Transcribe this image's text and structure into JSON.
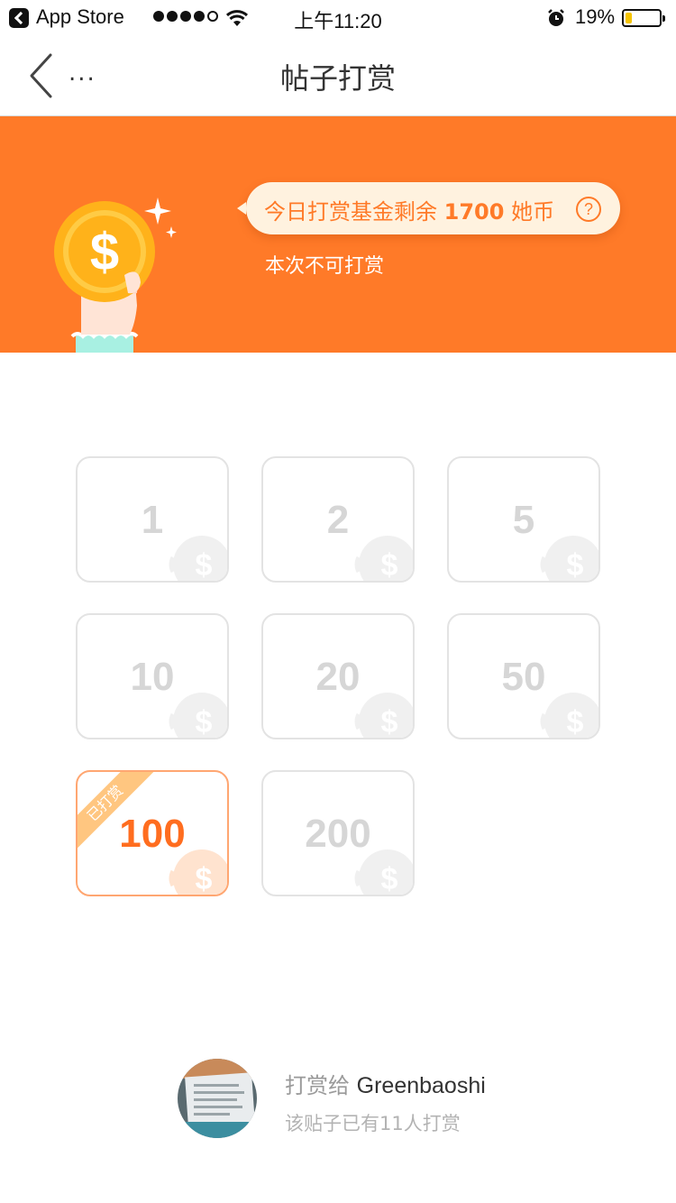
{
  "status_bar": {
    "back_app": "App Store",
    "signal_dots": 5,
    "signal_filled": 4,
    "time": "上午11:20",
    "battery_percent": "19%",
    "battery_level": 0.19,
    "battery_color": "#f5c400"
  },
  "nav": {
    "more": "...",
    "title": "帖子打赏"
  },
  "banner": {
    "bg_color": "#ff7a28",
    "fund_prefix": "今日打赏基金剩余",
    "fund_amount": "1700",
    "fund_unit": "她币",
    "help_icon": "?",
    "note": "本次不可打赏"
  },
  "tiles": [
    {
      "value": "1"
    },
    {
      "value": "2"
    },
    {
      "value": "5"
    },
    {
      "value": "10"
    },
    {
      "value": "20"
    },
    {
      "value": "50"
    },
    {
      "value": "100",
      "selected": true,
      "ribbon": "已打赏"
    },
    {
      "value": "200"
    }
  ],
  "footer": {
    "to_label": "打赏给",
    "recipient": "Greenbaoshi",
    "count_text": "该贴子已有11人打赏"
  }
}
